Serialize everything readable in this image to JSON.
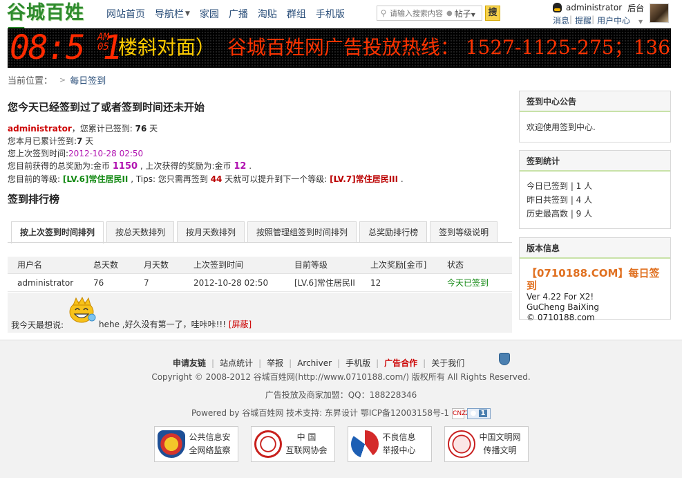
{
  "site": {
    "logo_text": "谷城百姓网"
  },
  "nav": [
    {
      "label": "网站首页",
      "dropdown": false
    },
    {
      "label": "导航栏",
      "dropdown": true
    },
    {
      "label": "家园",
      "dropdown": false
    },
    {
      "label": "广播",
      "dropdown": false
    },
    {
      "label": "淘贴",
      "dropdown": false
    },
    {
      "label": "群组",
      "dropdown": false
    },
    {
      "label": "手机版",
      "dropdown": false
    }
  ],
  "search": {
    "placeholder": "请输入搜索内容",
    "scope": "帖子",
    "button": "搜"
  },
  "user": {
    "name": "administrator",
    "admin_link": "后台",
    "messages": "消息",
    "reminders": "提醒",
    "center": "用户中心"
  },
  "banner": {
    "clock": "08:5 1",
    "clock_sec_top": "AM",
    "clock_sec_bottom": "05",
    "ticker_yellow": "楼斜对面）",
    "ticker_red": "谷城百姓网广告投放热线：  1527-1125-275；136"
  },
  "breadcrumb": {
    "prefix": "当前位置：",
    "current": "每日签到"
  },
  "main": {
    "title": "您今天已经签到过了或者签到时间还未开始",
    "line1": {
      "name": "administrator",
      "text1": "，您累计已签到: ",
      "total": "76",
      "text2": " 天"
    },
    "line2": {
      "text1": "您本月已累计签到:",
      "month": "7",
      "text2": " 天"
    },
    "line3": {
      "text1": "您上次签到时间:",
      "time": "2012-10-28 02:50"
    },
    "line4": {
      "text1": "您目前获得的总奖励为:金币 ",
      "total_reward": "1150",
      "text2": " , 上次获得的奖励为:金币 ",
      "last_reward": "12",
      "text3": " ."
    },
    "line5": {
      "text1": "您目前的等级: ",
      "level": "[LV.6]常住居民II",
      "text2": " , Tips: 您只需再签到 ",
      "days_needed": "44",
      "text3": " 天就可以提升到下一个等级: ",
      "next_level": "[LV.7]常住居民III",
      "text4": " ."
    },
    "rank_title": "签到排行榜",
    "tabs": [
      "按上次签到时间排列",
      "按总天数排列",
      "按月天数排列",
      "按照管理组签到时间排列",
      "总奖励排行榜",
      "签到等级说明"
    ],
    "table": {
      "headers": [
        "用户名",
        "总天数",
        "月天数",
        "上次签到时间",
        "目前等级",
        "上次奖励[金币]",
        "状态"
      ],
      "rows": [
        [
          "administrator",
          "76",
          "7",
          "2012-10-28 02:50",
          "[LV.6]常住居民II",
          "12",
          "今天已签到"
        ]
      ]
    },
    "say": {
      "label": "我今天最想说:",
      "message": "hehe ,好久没有第一了，哇咔咔!!!",
      "report": "[屏蔽]"
    }
  },
  "sidebar": {
    "notice": {
      "title": "签到中心公告",
      "body": "欢迎使用签到中心."
    },
    "stats": {
      "title": "签到统计",
      "lines": [
        "今日已签到 | 1 人",
        "昨日共签到 | 4 人",
        "历史最高数 | 9 人"
      ]
    },
    "version": {
      "title": "版本信息",
      "headline": "【0710188.COM】每日签到",
      "lines": [
        "Ver 4.22 For X2!",
        "GuCheng BaiXing",
        "© 0710188.com"
      ]
    }
  },
  "footer": {
    "links": [
      {
        "label": "申请友链",
        "style": "b"
      },
      {
        "label": "站点统计",
        "style": ""
      },
      {
        "label": "举报",
        "style": ""
      },
      {
        "label": "Archiver",
        "style": ""
      },
      {
        "label": "手机版",
        "style": ""
      },
      {
        "label": "广告合作",
        "style": "red"
      },
      {
        "label": "关于我们",
        "style": ""
      }
    ],
    "copyright": "Copyright © 2008-2012 谷城百姓网(http://www.0710188.com/) 版权所有 All Rights Reserved.",
    "ad_line": "广告投放及商家加盟：QQ：188228346",
    "powered": "Powered by 谷城百姓网   技术支持: 东昇设计  鄂ICP备12003158号-1",
    "stat_icon_text": "CNZZ",
    "paw_count": "1",
    "badges": [
      {
        "line1": "公共信息安",
        "line2": "全网络监察",
        "color": "#d4342c"
      },
      {
        "line1": "中 国",
        "line2": "互联网协会",
        "color": "#c8201c"
      },
      {
        "line1": "不良信息",
        "line2": "举报中心",
        "color": "#d42a2a"
      },
      {
        "line1": "中国文明网",
        "line2": "传播文明",
        "color": "#c81e1e"
      }
    ]
  }
}
